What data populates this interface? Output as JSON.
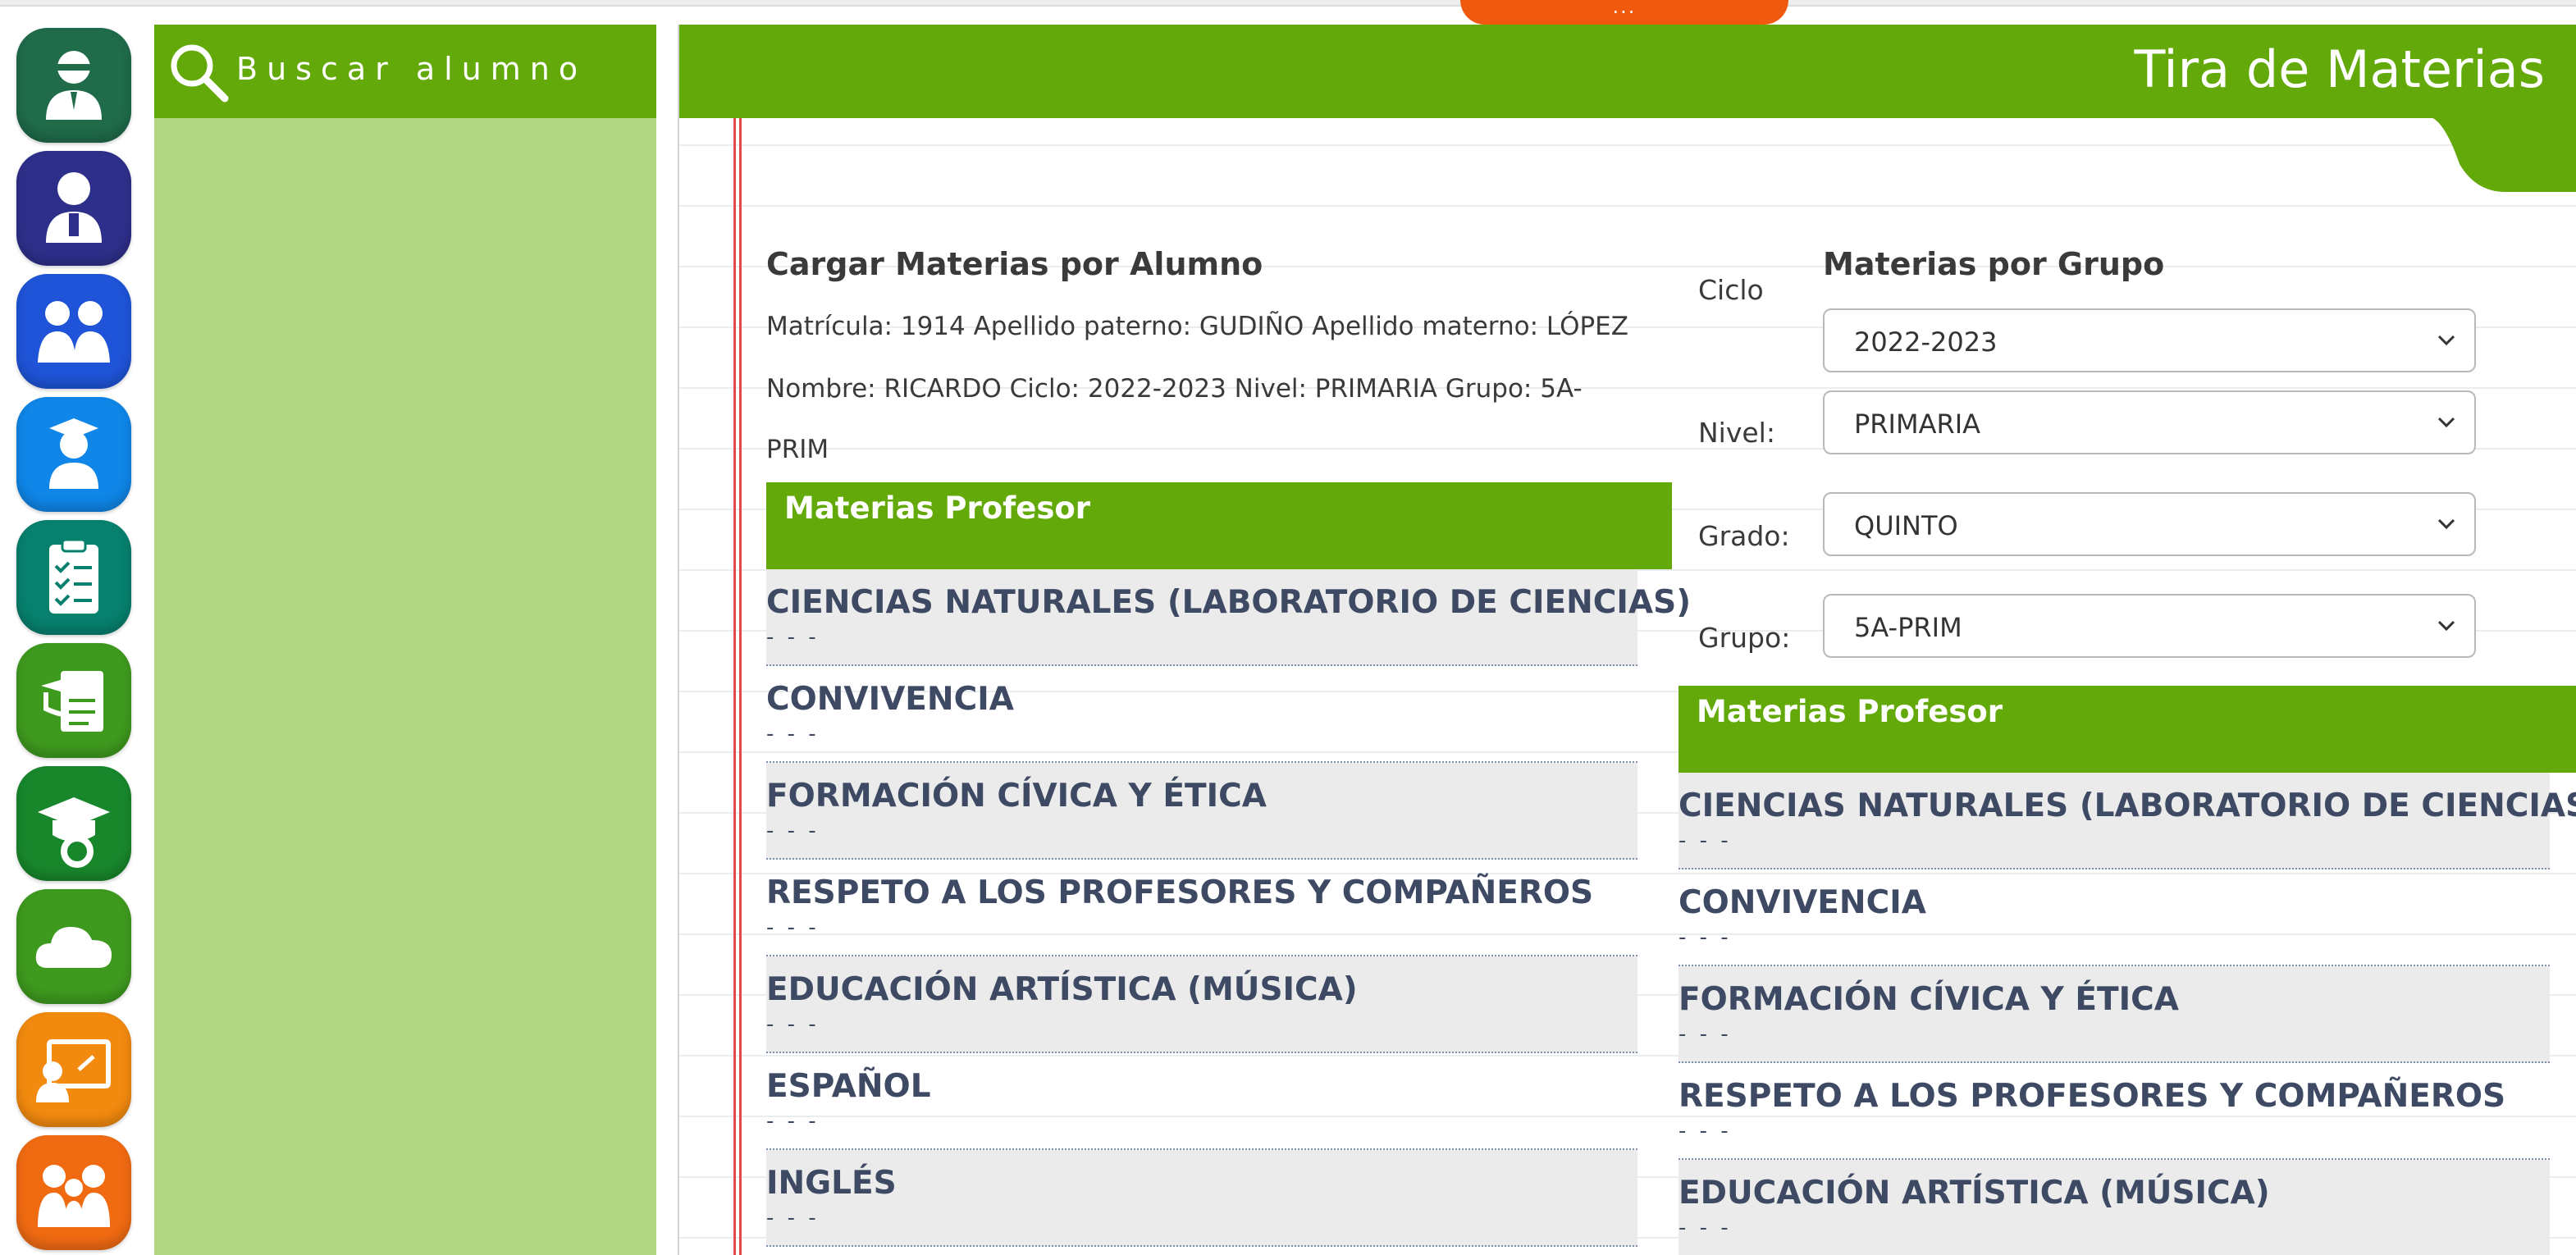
{
  "top_tab": {
    "label": "..."
  },
  "rail": [
    {
      "name": "teacher-icon",
      "color": "#1f6b4a"
    },
    {
      "name": "principal-icon",
      "color": "#2e2f8a"
    },
    {
      "name": "parents-icon",
      "color": "#1f54d8"
    },
    {
      "name": "graduate-icon",
      "color": "#0f86e8"
    },
    {
      "name": "checklist-icon",
      "color": "#07806e"
    },
    {
      "name": "documents-icon",
      "color": "#3e9a1e"
    },
    {
      "name": "graduation-settings-icon",
      "color": "#18872c"
    },
    {
      "name": "cloud-icon",
      "color": "#3e9a1e"
    },
    {
      "name": "presentation-icon",
      "color": "#f28a0f"
    },
    {
      "name": "family-icon",
      "color": "#f06a12"
    }
  ],
  "search": {
    "label": "Buscar alumno"
  },
  "header": {
    "title": "Tira de Materias"
  },
  "student_section": {
    "title": "Cargar Materias por Alumno",
    "line1": "Matrícula: 1914 Apellido paterno: GUDIÑO Apellido materno: LÓPEZ",
    "line2": "Nombre: RICARDO Ciclo: 2022-2023 Nivel: PRIMARIA Grupo: 5A-",
    "line3": "PRIM",
    "panel_title": "Materias Profesor",
    "subjects": [
      {
        "name": "CIENCIAS NATURALES (LABORATORIO DE CIENCIAS)",
        "teacher": "- - -"
      },
      {
        "name": "CONVIVENCIA",
        "teacher": "- - -"
      },
      {
        "name": "FORMACIÓN CÍVICA Y ÉTICA",
        "teacher": "- - -"
      },
      {
        "name": "RESPETO A LOS PROFESORES Y COMPAÑEROS",
        "teacher": "- - -"
      },
      {
        "name": "EDUCACIÓN ARTÍSTICA (MÚSICA)",
        "teacher": "- - -"
      },
      {
        "name": "ESPAÑOL",
        "teacher": "- - -"
      },
      {
        "name": "INGLÉS",
        "teacher": "- - -"
      }
    ]
  },
  "group_section": {
    "title": "Materias por Grupo",
    "fields": {
      "ciclo": {
        "label": "Ciclo",
        "value": "2022-2023"
      },
      "nivel": {
        "label": "Nivel:",
        "value": "PRIMARIA"
      },
      "grado": {
        "label": "Grado:",
        "value": "QUINTO"
      },
      "grupo": {
        "label": "Grupo:",
        "value": "5A-PRIM"
      }
    },
    "panel_title": "Materias Profesor",
    "subjects": [
      {
        "name": "CIENCIAS NATURALES (LABORATORIO DE CIENCIAS)",
        "teacher": "- - -"
      },
      {
        "name": "CONVIVENCIA",
        "teacher": "- - -"
      },
      {
        "name": "FORMACIÓN CÍVICA Y ÉTICA",
        "teacher": "- - -"
      },
      {
        "name": "RESPETO A LOS PROFESORES Y COMPAÑEROS",
        "teacher": "- - -"
      },
      {
        "name": "EDUCACIÓN ARTÍSTICA (MÚSICA)",
        "teacher": "- - -"
      }
    ]
  },
  "colors": {
    "brand_green": "#63a90a",
    "panel_green": "#b2d682",
    "accent_orange": "#f05a0f",
    "subject_text": "#3e4a63"
  }
}
